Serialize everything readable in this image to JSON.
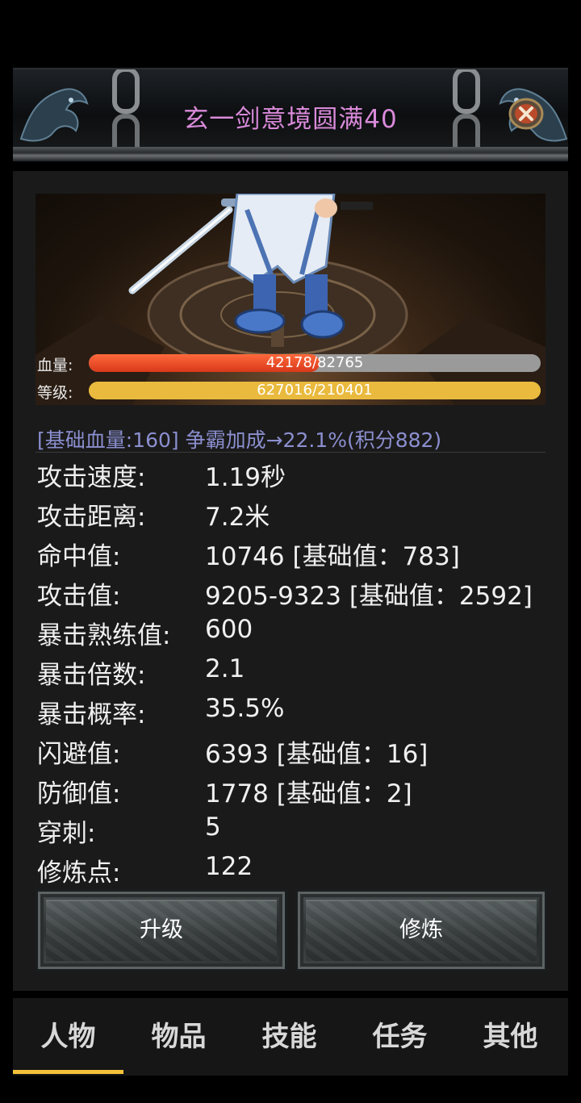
{
  "header": {
    "title": "玄一剑意境圆满40",
    "close_icon": "close-icon"
  },
  "status": {
    "hp_label": "血量:",
    "hp_text": "42178/82765",
    "hp_ratio": 0.51,
    "level_label": "等级:",
    "level_text": "627016/210401",
    "level_ratio": 1.0
  },
  "bonus_line": "[基础血量:160]  争霸加成→22.1%(积分882)",
  "stats": [
    {
      "name": "攻击速度:",
      "value": "1.19秒"
    },
    {
      "name": "攻击距离:",
      "value": "7.2米"
    },
    {
      "name": "命中值:",
      "value": "10746 [基础值：783]"
    },
    {
      "name": "攻击值:",
      "value": "9205-9323 [基础值：2592]"
    },
    {
      "name": "暴击熟练值:",
      "value": "600"
    },
    {
      "name": "暴击倍数:",
      "value": "2.1"
    },
    {
      "name": "暴击概率:",
      "value": "35.5%"
    },
    {
      "name": "闪避值:",
      "value": "6393 [基础值：16]"
    },
    {
      "name": "防御值:",
      "value": "1778 [基础值：2]"
    },
    {
      "name": "穿刺:",
      "value": "5"
    },
    {
      "name": "修炼点:",
      "value": "122"
    }
  ],
  "buttons": {
    "upgrade": "升级",
    "train": "修炼"
  },
  "tabs": [
    {
      "label": "人物",
      "active": true
    },
    {
      "label": "物品",
      "active": false
    },
    {
      "label": "技能",
      "active": false
    },
    {
      "label": "任务",
      "active": false
    },
    {
      "label": "其他",
      "active": false
    }
  ],
  "colors": {
    "title": "#d98ad9",
    "bonus": "#8b8fcf",
    "active_tab": "#f2c23a",
    "hp": "#e8401e",
    "level": "#e9ba3e"
  }
}
